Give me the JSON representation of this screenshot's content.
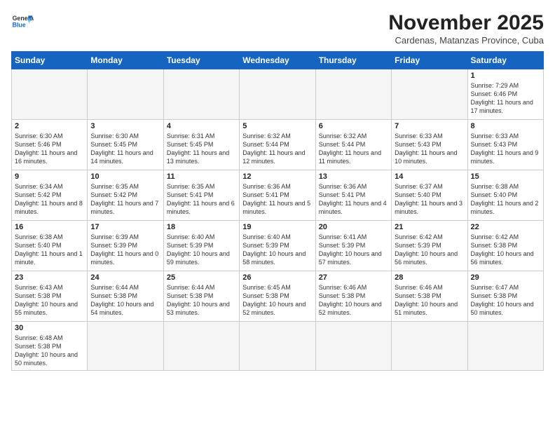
{
  "header": {
    "logo_general": "General",
    "logo_blue": "Blue",
    "month_year": "November 2025",
    "location": "Cardenas, Matanzas Province, Cuba"
  },
  "days_of_week": [
    "Sunday",
    "Monday",
    "Tuesday",
    "Wednesday",
    "Thursday",
    "Friday",
    "Saturday"
  ],
  "weeks": [
    [
      {
        "day": "",
        "info": ""
      },
      {
        "day": "",
        "info": ""
      },
      {
        "day": "",
        "info": ""
      },
      {
        "day": "",
        "info": ""
      },
      {
        "day": "",
        "info": ""
      },
      {
        "day": "",
        "info": ""
      },
      {
        "day": "1",
        "info": "Sunrise: 7:29 AM\nSunset: 6:46 PM\nDaylight: 11 hours and 17 minutes."
      }
    ],
    [
      {
        "day": "2",
        "info": "Sunrise: 6:30 AM\nSunset: 5:46 PM\nDaylight: 11 hours and 16 minutes."
      },
      {
        "day": "3",
        "info": "Sunrise: 6:30 AM\nSunset: 5:45 PM\nDaylight: 11 hours and 14 minutes."
      },
      {
        "day": "4",
        "info": "Sunrise: 6:31 AM\nSunset: 5:45 PM\nDaylight: 11 hours and 13 minutes."
      },
      {
        "day": "5",
        "info": "Sunrise: 6:32 AM\nSunset: 5:44 PM\nDaylight: 11 hours and 12 minutes."
      },
      {
        "day": "6",
        "info": "Sunrise: 6:32 AM\nSunset: 5:44 PM\nDaylight: 11 hours and 11 minutes."
      },
      {
        "day": "7",
        "info": "Sunrise: 6:33 AM\nSunset: 5:43 PM\nDaylight: 11 hours and 10 minutes."
      },
      {
        "day": "8",
        "info": "Sunrise: 6:33 AM\nSunset: 5:43 PM\nDaylight: 11 hours and 9 minutes."
      }
    ],
    [
      {
        "day": "9",
        "info": "Sunrise: 6:34 AM\nSunset: 5:42 PM\nDaylight: 11 hours and 8 minutes."
      },
      {
        "day": "10",
        "info": "Sunrise: 6:35 AM\nSunset: 5:42 PM\nDaylight: 11 hours and 7 minutes."
      },
      {
        "day": "11",
        "info": "Sunrise: 6:35 AM\nSunset: 5:41 PM\nDaylight: 11 hours and 6 minutes."
      },
      {
        "day": "12",
        "info": "Sunrise: 6:36 AM\nSunset: 5:41 PM\nDaylight: 11 hours and 5 minutes."
      },
      {
        "day": "13",
        "info": "Sunrise: 6:36 AM\nSunset: 5:41 PM\nDaylight: 11 hours and 4 minutes."
      },
      {
        "day": "14",
        "info": "Sunrise: 6:37 AM\nSunset: 5:40 PM\nDaylight: 11 hours and 3 minutes."
      },
      {
        "day": "15",
        "info": "Sunrise: 6:38 AM\nSunset: 5:40 PM\nDaylight: 11 hours and 2 minutes."
      }
    ],
    [
      {
        "day": "16",
        "info": "Sunrise: 6:38 AM\nSunset: 5:40 PM\nDaylight: 11 hours and 1 minute."
      },
      {
        "day": "17",
        "info": "Sunrise: 6:39 AM\nSunset: 5:39 PM\nDaylight: 11 hours and 0 minutes."
      },
      {
        "day": "18",
        "info": "Sunrise: 6:40 AM\nSunset: 5:39 PM\nDaylight: 10 hours and 59 minutes."
      },
      {
        "day": "19",
        "info": "Sunrise: 6:40 AM\nSunset: 5:39 PM\nDaylight: 10 hours and 58 minutes."
      },
      {
        "day": "20",
        "info": "Sunrise: 6:41 AM\nSunset: 5:39 PM\nDaylight: 10 hours and 57 minutes."
      },
      {
        "day": "21",
        "info": "Sunrise: 6:42 AM\nSunset: 5:39 PM\nDaylight: 10 hours and 56 minutes."
      },
      {
        "day": "22",
        "info": "Sunrise: 6:42 AM\nSunset: 5:38 PM\nDaylight: 10 hours and 56 minutes."
      }
    ],
    [
      {
        "day": "23",
        "info": "Sunrise: 6:43 AM\nSunset: 5:38 PM\nDaylight: 10 hours and 55 minutes."
      },
      {
        "day": "24",
        "info": "Sunrise: 6:44 AM\nSunset: 5:38 PM\nDaylight: 10 hours and 54 minutes."
      },
      {
        "day": "25",
        "info": "Sunrise: 6:44 AM\nSunset: 5:38 PM\nDaylight: 10 hours and 53 minutes."
      },
      {
        "day": "26",
        "info": "Sunrise: 6:45 AM\nSunset: 5:38 PM\nDaylight: 10 hours and 52 minutes."
      },
      {
        "day": "27",
        "info": "Sunrise: 6:46 AM\nSunset: 5:38 PM\nDaylight: 10 hours and 52 minutes."
      },
      {
        "day": "28",
        "info": "Sunrise: 6:46 AM\nSunset: 5:38 PM\nDaylight: 10 hours and 51 minutes."
      },
      {
        "day": "29",
        "info": "Sunrise: 6:47 AM\nSunset: 5:38 PM\nDaylight: 10 hours and 50 minutes."
      }
    ],
    [
      {
        "day": "30",
        "info": "Sunrise: 6:48 AM\nSunset: 5:38 PM\nDaylight: 10 hours and 50 minutes."
      },
      {
        "day": "",
        "info": ""
      },
      {
        "day": "",
        "info": ""
      },
      {
        "day": "",
        "info": ""
      },
      {
        "day": "",
        "info": ""
      },
      {
        "day": "",
        "info": ""
      },
      {
        "day": "",
        "info": ""
      }
    ]
  ]
}
